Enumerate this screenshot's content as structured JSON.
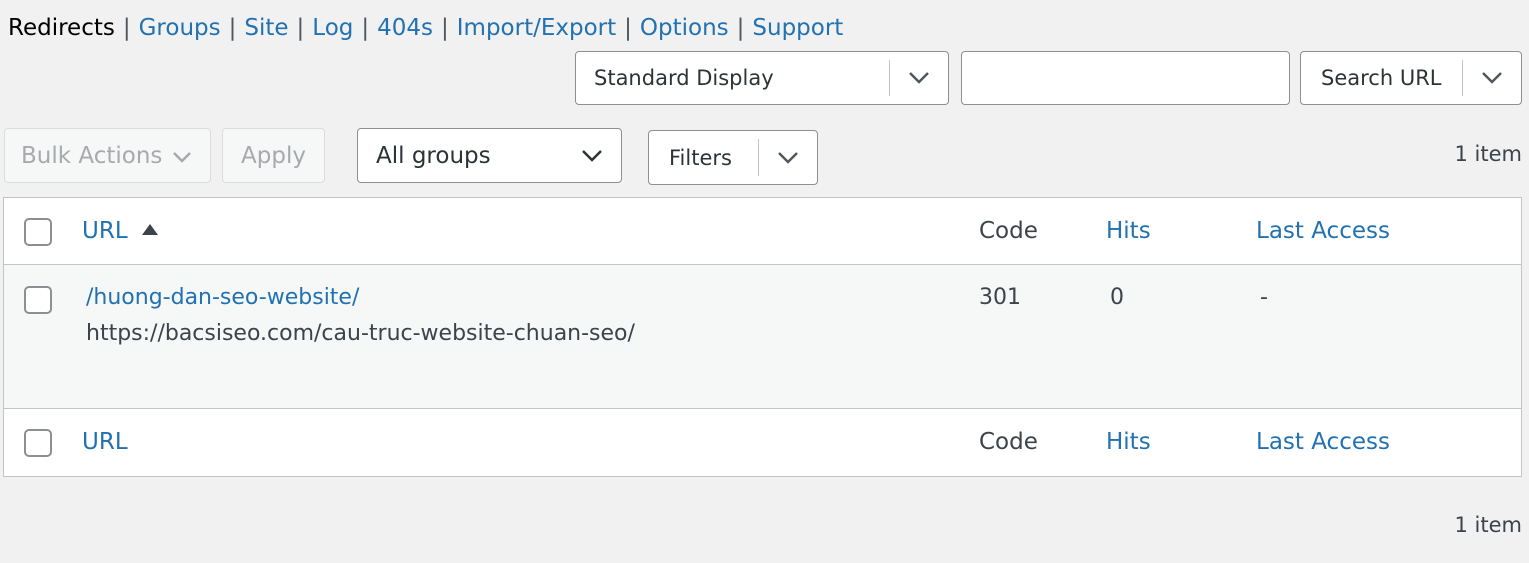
{
  "subnav": {
    "current": "Redirects",
    "links": [
      "Groups",
      "Site",
      "Log",
      "404s",
      "Import/Export",
      "Options",
      "Support"
    ],
    "separator": "|"
  },
  "display_select": {
    "value": "Standard Display"
  },
  "search": {
    "value": "",
    "placeholder": ""
  },
  "search_mode_select": {
    "value": "Search URL"
  },
  "bulk_actions": {
    "label": "Bulk Actions"
  },
  "apply_button": {
    "label": "Apply"
  },
  "group_select": {
    "value": "All groups"
  },
  "filters_button": {
    "label": "Filters"
  },
  "item_count": "1 item",
  "table": {
    "columns": {
      "url": "URL",
      "code": "Code",
      "hits": "Hits",
      "last_access": "Last Access"
    },
    "rows": [
      {
        "source": "/huong-dan-seo-website/",
        "target": "https://bacsiseo.com/cau-truc-website-chuan-seo/",
        "code": "301",
        "hits": "0",
        "last_access": "-"
      }
    ]
  },
  "colors": {
    "link": "#2271b1",
    "background": "#f1f1f1"
  }
}
